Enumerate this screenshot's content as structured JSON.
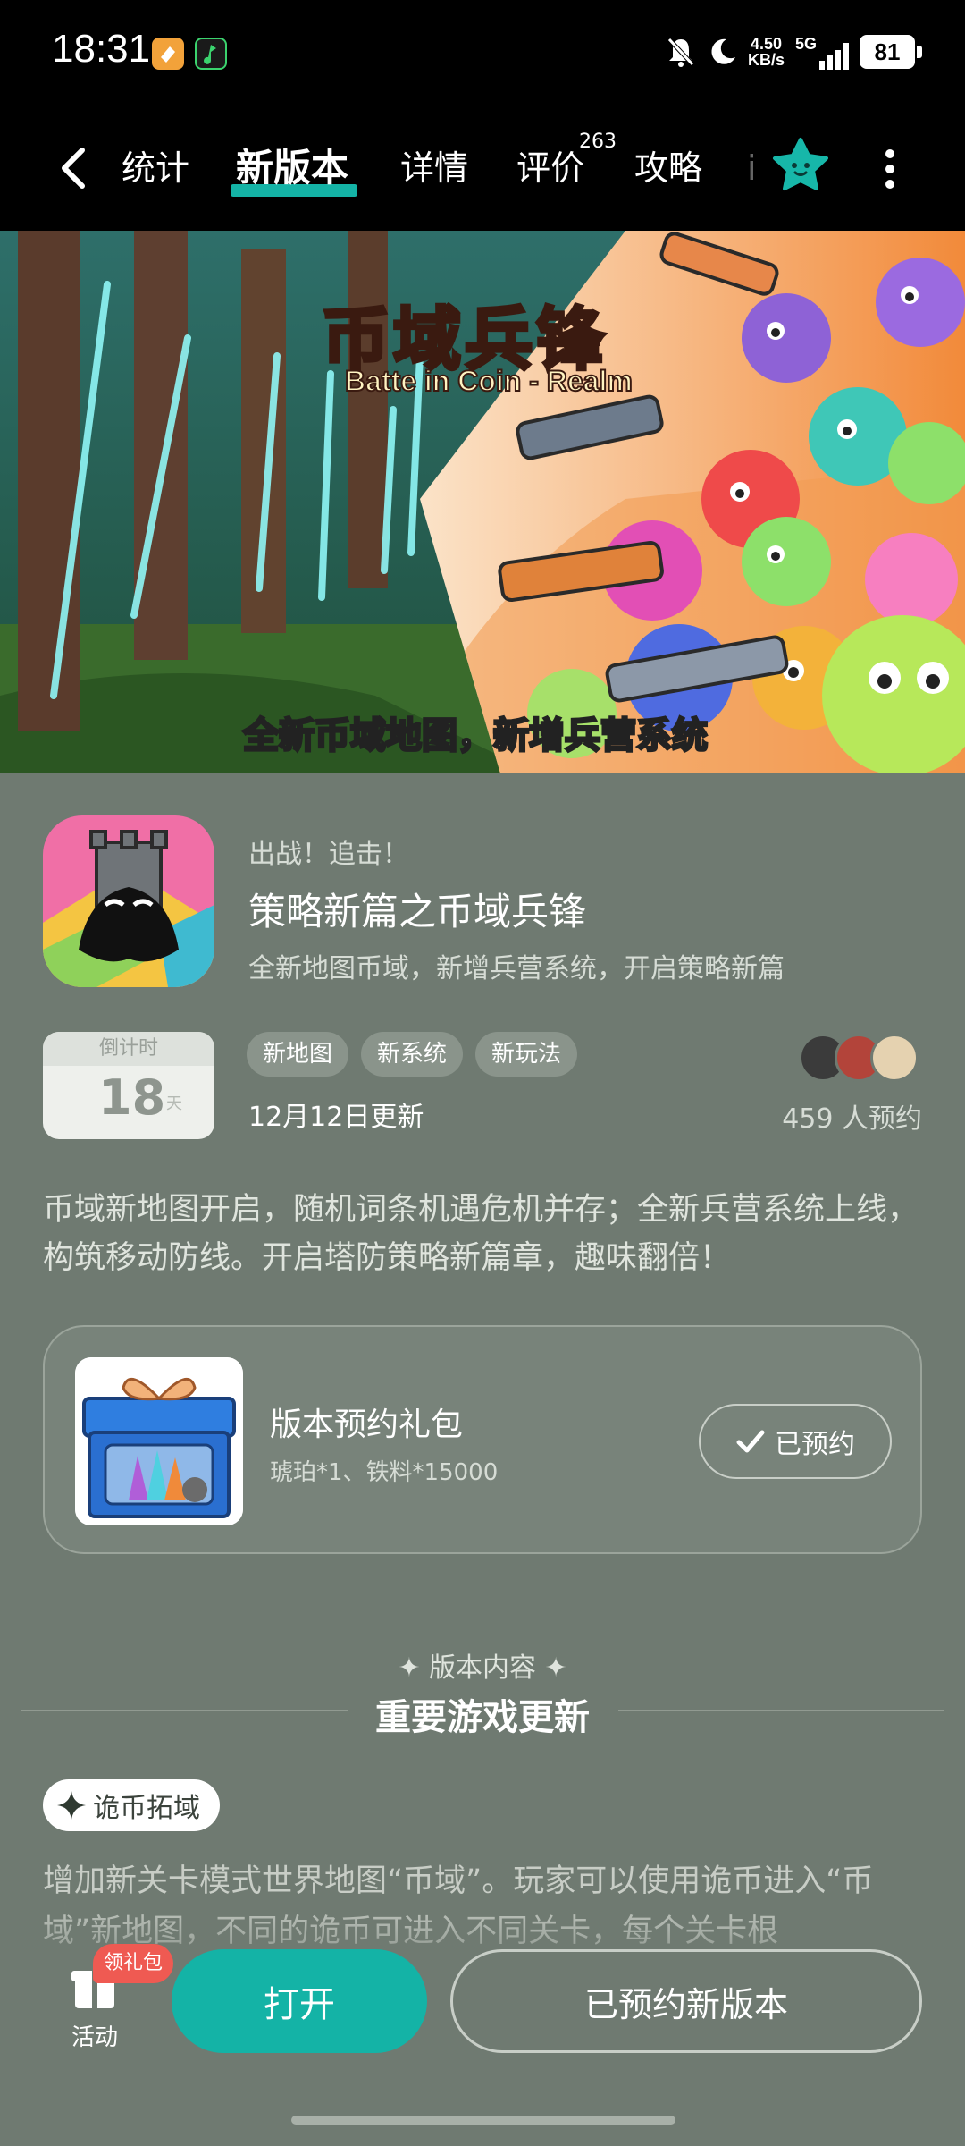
{
  "status_bar": {
    "time": "18:31",
    "net_speed_value": "4.50",
    "net_speed_unit": "KB/s",
    "network": "5G",
    "battery": "81",
    "icons": [
      "app-notification-icon-orange",
      "app-notification-icon-green",
      "mute-bell-icon",
      "moon-icon",
      "signal-icon"
    ]
  },
  "nav": {
    "tabs": [
      {
        "label": "统计"
      },
      {
        "label": "新版本",
        "active": true
      },
      {
        "label": "详情"
      },
      {
        "label": "评价",
        "badge": "263"
      },
      {
        "label": "攻略"
      }
    ],
    "accent_color": "#14b3a6"
  },
  "banner": {
    "title": "币域兵锋",
    "subtitle": "Batte in Coin - Realm",
    "caption": "全新币域地图，新增兵营系统"
  },
  "update": {
    "kicker": "出战！追击！",
    "headline": "策略新篇之币域兵锋",
    "summary": "全新地图币域，新增兵营系统，开启策略新篇",
    "countdown_label": "倒计时",
    "countdown_value": "18",
    "countdown_unit": "天",
    "tags": [
      "新地图",
      "新系统",
      "新玩法"
    ],
    "date": "12月12日更新",
    "reserve_count": "459 人预约",
    "description": "币域新地图开启，随机词条机遇危机并存；全新兵营系统上线，构筑移动防线。开启塔防策略新篇章，趣味翻倍！"
  },
  "gift": {
    "title": "版本预约礼包",
    "desc": "琥珀*1、铁料*15000",
    "button": "已预约"
  },
  "section": {
    "kicker": "版本内容",
    "title": "重要游戏更新",
    "feature_chip": "诡币拓域",
    "feature_text": "增加新关卡模式世界地图“币域”。玩家可以使用诡币进入“币域”新地图，不同的诡币可进入不同关卡，每个关卡根"
  },
  "bottom": {
    "activity_label": "活动",
    "gift_badge": "领礼包",
    "open_button": "打开",
    "reserved_button": "已预约新版本"
  }
}
